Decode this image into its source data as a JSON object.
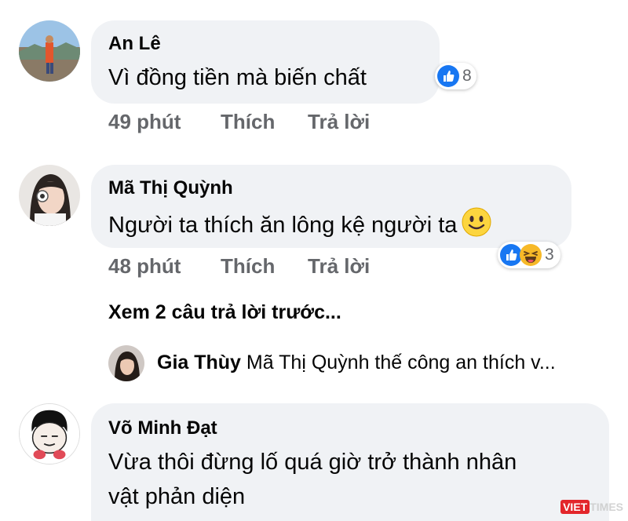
{
  "comments": [
    {
      "author": "An Lê",
      "text": "Vì đồng tiền mà biến chất",
      "time": "49 phút",
      "like_label": "Thích",
      "reply_label": "Trả lời",
      "reaction_count": "8",
      "reactions": [
        "like-icon"
      ]
    },
    {
      "author": "Mã Thị Quỳnh",
      "text": "Người ta thích ăn lông kệ người ta",
      "emoji": "slightly-smiling-face-icon",
      "time": "48 phút",
      "like_label": "Thích",
      "reply_label": "Trả lời",
      "reaction_count": "3",
      "reactions": [
        "like-icon",
        "haha-icon"
      ],
      "view_previous_replies": "Xem 2 câu trả lời trước...",
      "reply_preview": {
        "author": "Gia Thùy",
        "text": "Mã Thị Quỳnh thế công an thích v..."
      }
    },
    {
      "author": "Võ Minh Đạt",
      "text_line1": "Vừa thôi đừng lố quá giờ trở thành nhân",
      "text_line2": "vật phản diện"
    }
  ],
  "watermark": {
    "part1": "VIET",
    "part2": "TIMES"
  },
  "colors": {
    "bubble": "#f0f2f5",
    "like_blue": "#1877f2",
    "meta_gray": "#65676b",
    "haha_yellow": "#f7b928"
  }
}
